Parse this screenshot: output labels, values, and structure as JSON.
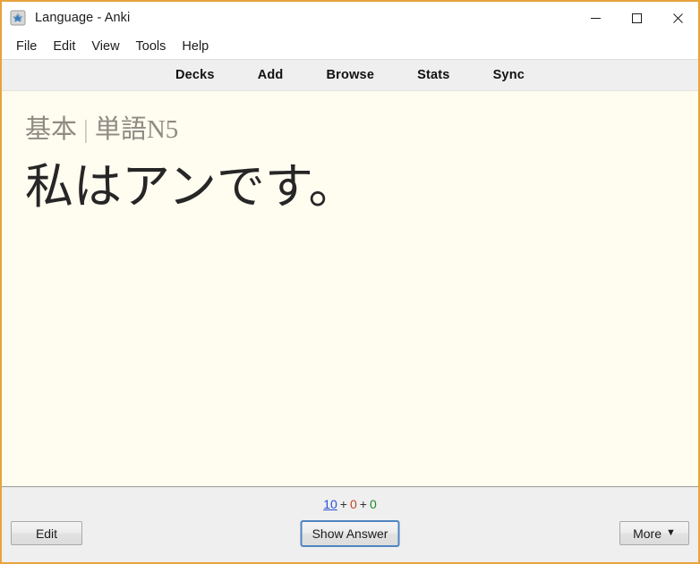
{
  "window": {
    "title": "Language - Anki",
    "icon": "anki-app-icon",
    "border_color": "#e8a33d",
    "controls": {
      "minimize": "minimize-icon",
      "maximize": "maximize-icon",
      "close": "close-icon"
    }
  },
  "menu": {
    "items": [
      {
        "label": "File"
      },
      {
        "label": "Edit"
      },
      {
        "label": "View"
      },
      {
        "label": "Tools"
      },
      {
        "label": "Help"
      }
    ]
  },
  "toolbar": {
    "links": [
      {
        "label": "Decks"
      },
      {
        "label": "Add"
      },
      {
        "label": "Browse"
      },
      {
        "label": "Stats"
      },
      {
        "label": "Sync"
      }
    ]
  },
  "reviewer": {
    "deck_parent": "基本",
    "deck_separator": "|",
    "deck_child": "単語N5",
    "question_text": "私はアンです。",
    "background_color": "#fffcf0"
  },
  "bottom": {
    "counts": {
      "new": "10",
      "learning": "0",
      "due": "0",
      "separator": "+",
      "new_color": "#2b4fd6",
      "learning_color": "#c1441e",
      "due_color": "#1a8a2e"
    },
    "edit_label": "Edit",
    "show_answer_label": "Show Answer",
    "more_label": "More",
    "more_caret": "▼"
  }
}
